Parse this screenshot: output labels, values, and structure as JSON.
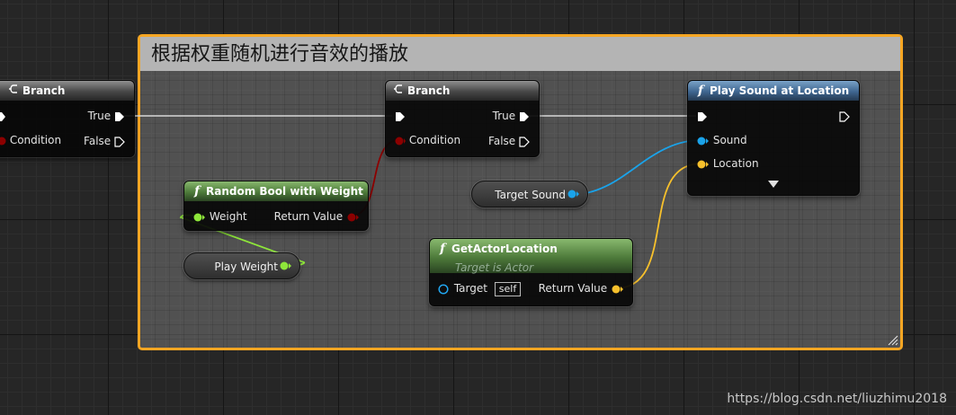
{
  "comment": {
    "title": "根据权重随机进行音效的播放",
    "border_color": "#f6a623"
  },
  "nodes": {
    "branch_left": {
      "title": "Branch",
      "true_label": "True",
      "condition_label": "Condition",
      "false_label": "False"
    },
    "branch_main": {
      "title": "Branch",
      "true_label": "True",
      "condition_label": "Condition",
      "false_label": "False"
    },
    "random_bool": {
      "title": "Random Bool with Weight",
      "weight_label": "Weight",
      "return_label": "Return Value"
    },
    "play_sound": {
      "title": "Play Sound at Location",
      "sound_label": "Sound",
      "location_label": "Location"
    },
    "get_actor_location": {
      "title": "GetActorLocation",
      "subtitle": "Target is Actor",
      "target_label": "Target",
      "self_label": "self",
      "return_label": "Return Value"
    },
    "target_sound": {
      "label": "Target Sound"
    },
    "play_weight": {
      "label": "Play Weight"
    }
  },
  "icons": {
    "branch": "branch-icon",
    "function": "function-icon",
    "exec": "exec-pin-icon",
    "expand": "expand-arrow-icon"
  },
  "colors": {
    "exec": "#ffffff",
    "bool": "#8c0000",
    "float": "#8ee63a",
    "sound": "#1aa3ea",
    "vector": "#f7c02c",
    "object": "#21a6f0"
  },
  "watermark": "https://blog.csdn.net/liuzhimu2018"
}
